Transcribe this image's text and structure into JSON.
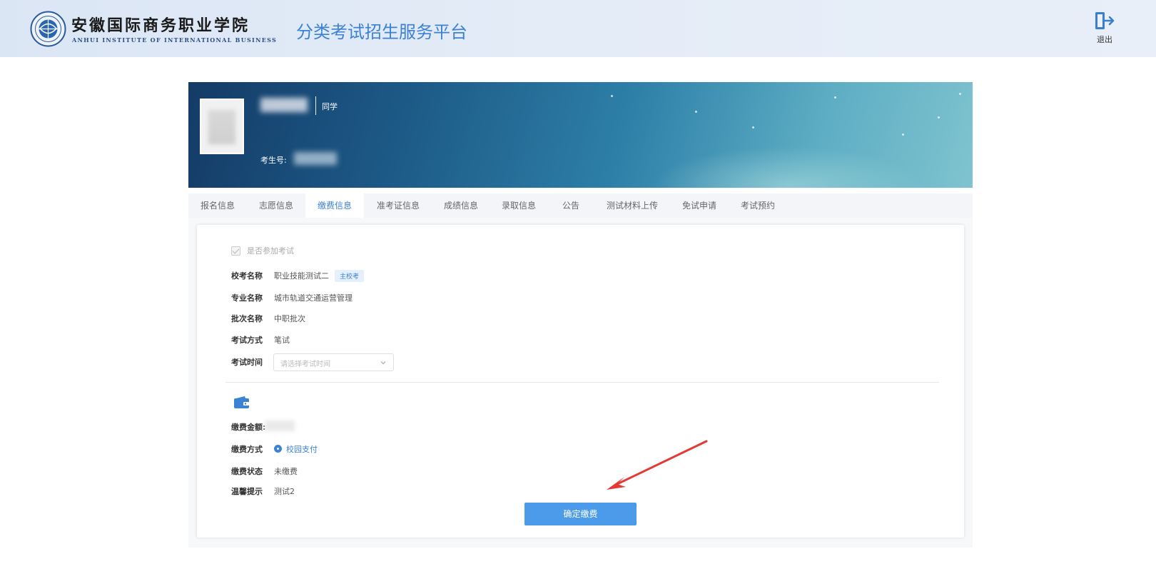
{
  "header": {
    "school_name_cn": "安徽国际商务职业学院",
    "school_name_en": "ANHUI INSTITUTE OF INTERNATIONAL BUSINESS",
    "platform_title": "分类考试招生服务平台",
    "logout_label": "退出"
  },
  "profile": {
    "suffix": "同学",
    "exam_no_label": "考生号:"
  },
  "tabs": [
    {
      "label": "报名信息",
      "active": false
    },
    {
      "label": "志愿信息",
      "active": false
    },
    {
      "label": "缴费信息",
      "active": true
    },
    {
      "label": "准考证信息",
      "active": false
    },
    {
      "label": "成绩信息",
      "active": false
    },
    {
      "label": "录取信息",
      "active": false
    },
    {
      "label": "公告",
      "active": false
    },
    {
      "label": "测试材料上传",
      "active": false
    },
    {
      "label": "免试申请",
      "active": false
    },
    {
      "label": "考试预约",
      "active": false
    }
  ],
  "form": {
    "participate_label": "是否参加考试",
    "school_exam": {
      "label": "校考名称",
      "value": "职业技能测试二",
      "badge": "主校考"
    },
    "major": {
      "label": "专业名称",
      "value": "城市轨道交通运营管理"
    },
    "batch": {
      "label": "批次名称",
      "value": "中职批次"
    },
    "exam_method": {
      "label": "考试方式",
      "value": "笔试"
    },
    "exam_time": {
      "label": "考试时间",
      "placeholder": "请选择考试时间"
    }
  },
  "payment": {
    "amount_label": "缴费金额:",
    "method_label": "缴费方式",
    "method_value": "校园支付",
    "status_label": "缴费状态",
    "status_value": "未缴费",
    "tip_label": "温馨提示",
    "tip_value": "测试2",
    "confirm_button": "确定缴费"
  },
  "colors": {
    "accent": "#3b82d6",
    "button": "#4b9bea",
    "annotation_arrow": "#e53935"
  }
}
